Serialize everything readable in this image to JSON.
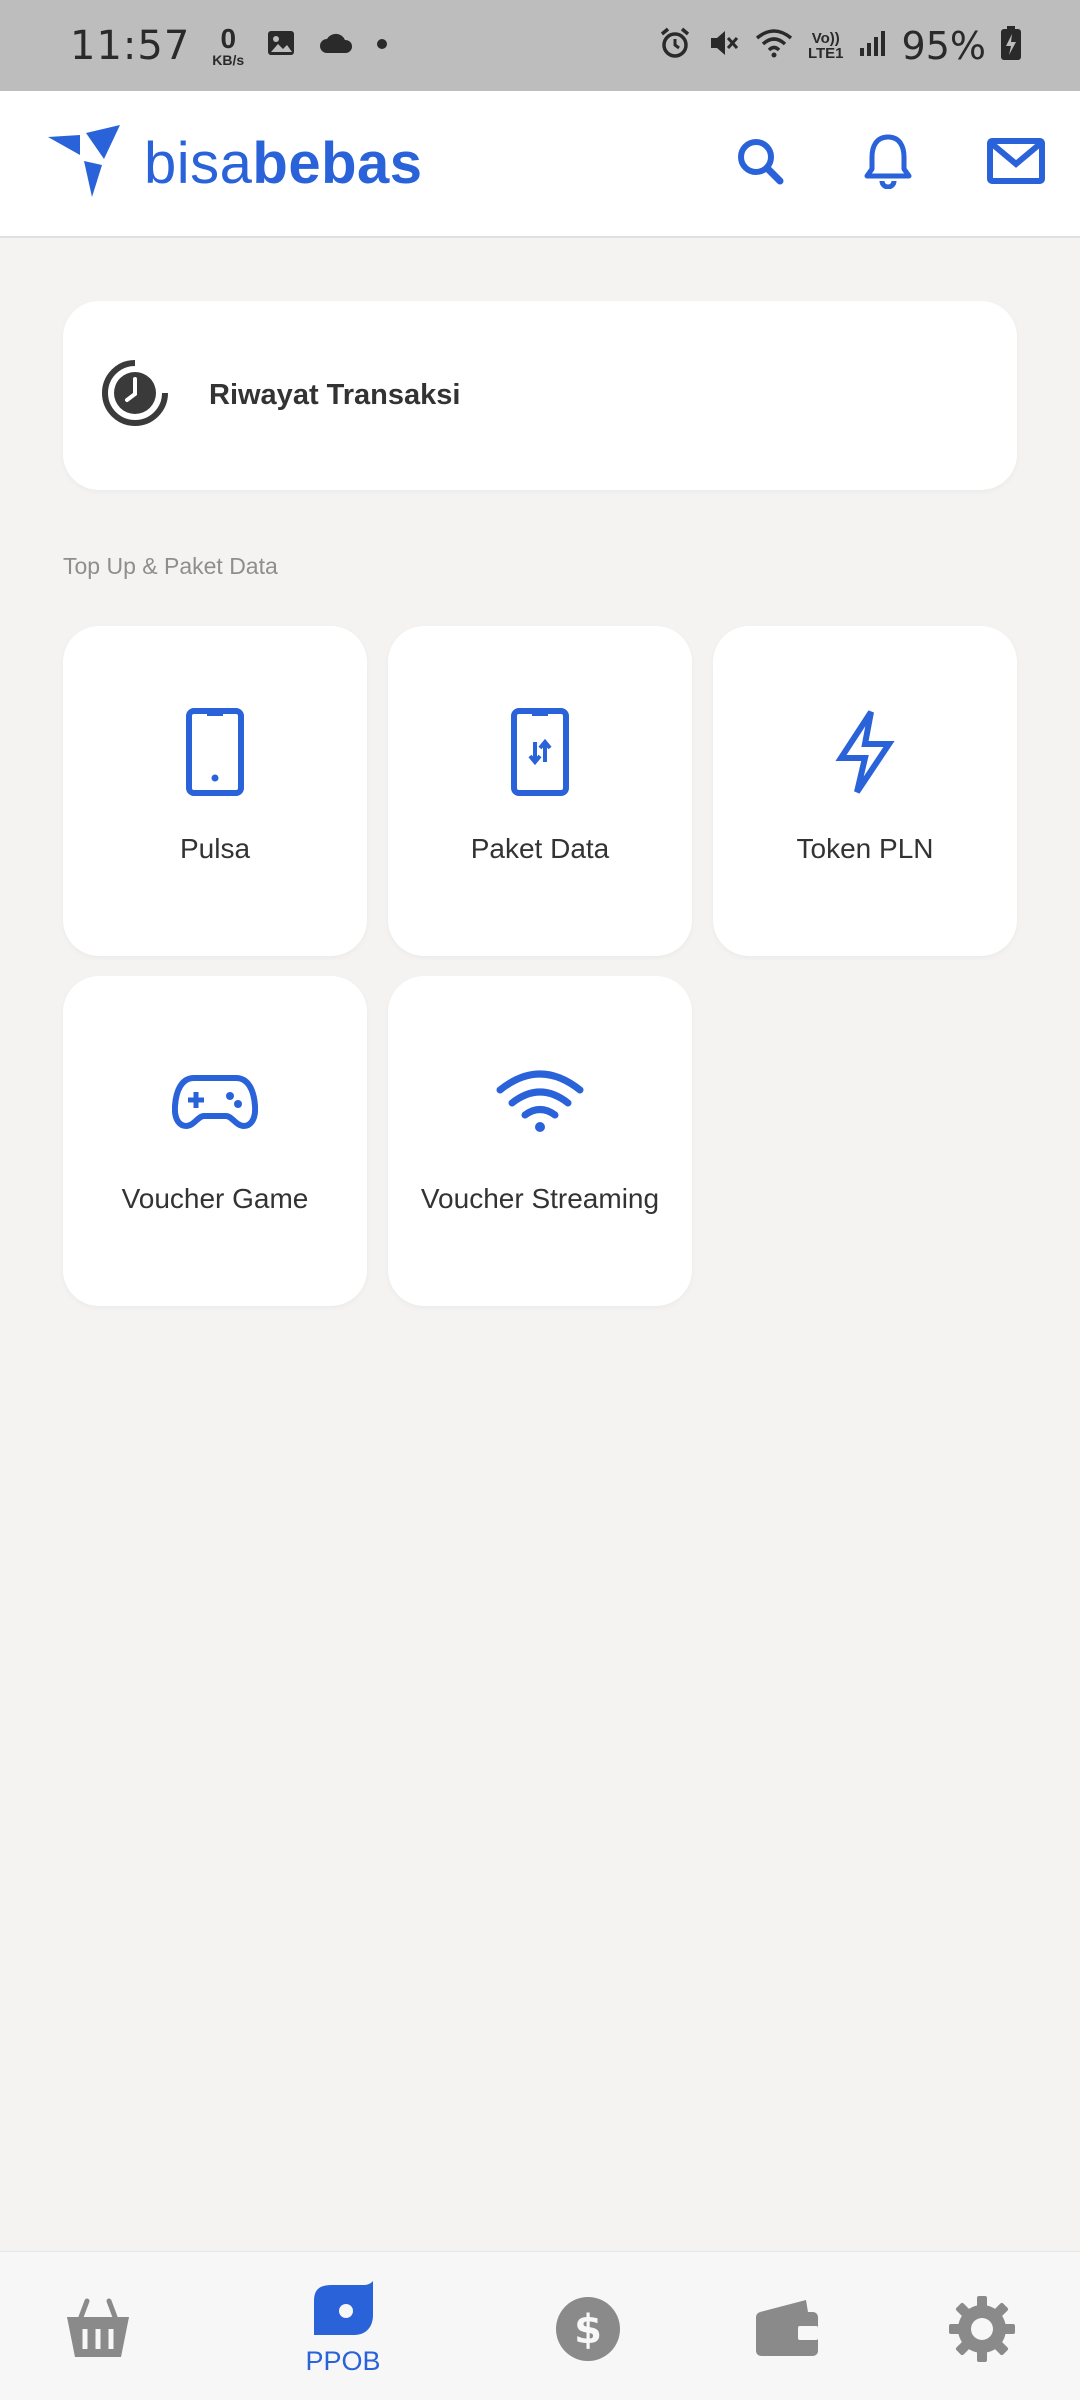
{
  "status_bar": {
    "time": "11:57",
    "speed_value": "0",
    "speed_unit": "KB/s",
    "network_top": "Vo))",
    "network_bottom": "LTE1",
    "battery": "95%"
  },
  "header": {
    "logo_light": "bisa",
    "logo_bold": "bebas",
    "icons": [
      "search-icon",
      "bell-icon",
      "mail-icon"
    ]
  },
  "history": {
    "label": "Riwayat Transaksi"
  },
  "section": {
    "title": "Top Up & Paket Data"
  },
  "services": [
    {
      "label": "Pulsa",
      "icon": "phone-icon"
    },
    {
      "label": "Paket Data",
      "icon": "phone-data-icon"
    },
    {
      "label": "Token PLN",
      "icon": "lightning-icon"
    },
    {
      "label": "Voucher Game",
      "icon": "gamepad-icon"
    },
    {
      "label": "Voucher Streaming",
      "icon": "wifi-icon"
    }
  ],
  "bottom_nav": {
    "active_label": "PPOB",
    "items": [
      "basket-icon",
      "ppob-icon",
      "dollar-icon",
      "wallet-icon",
      "settings-icon"
    ]
  },
  "colors": {
    "accent": "#2962d9",
    "inactive_nav": "#8a8a8a",
    "background": "#f4f3f2",
    "status_bar": "#bdbdbd"
  }
}
